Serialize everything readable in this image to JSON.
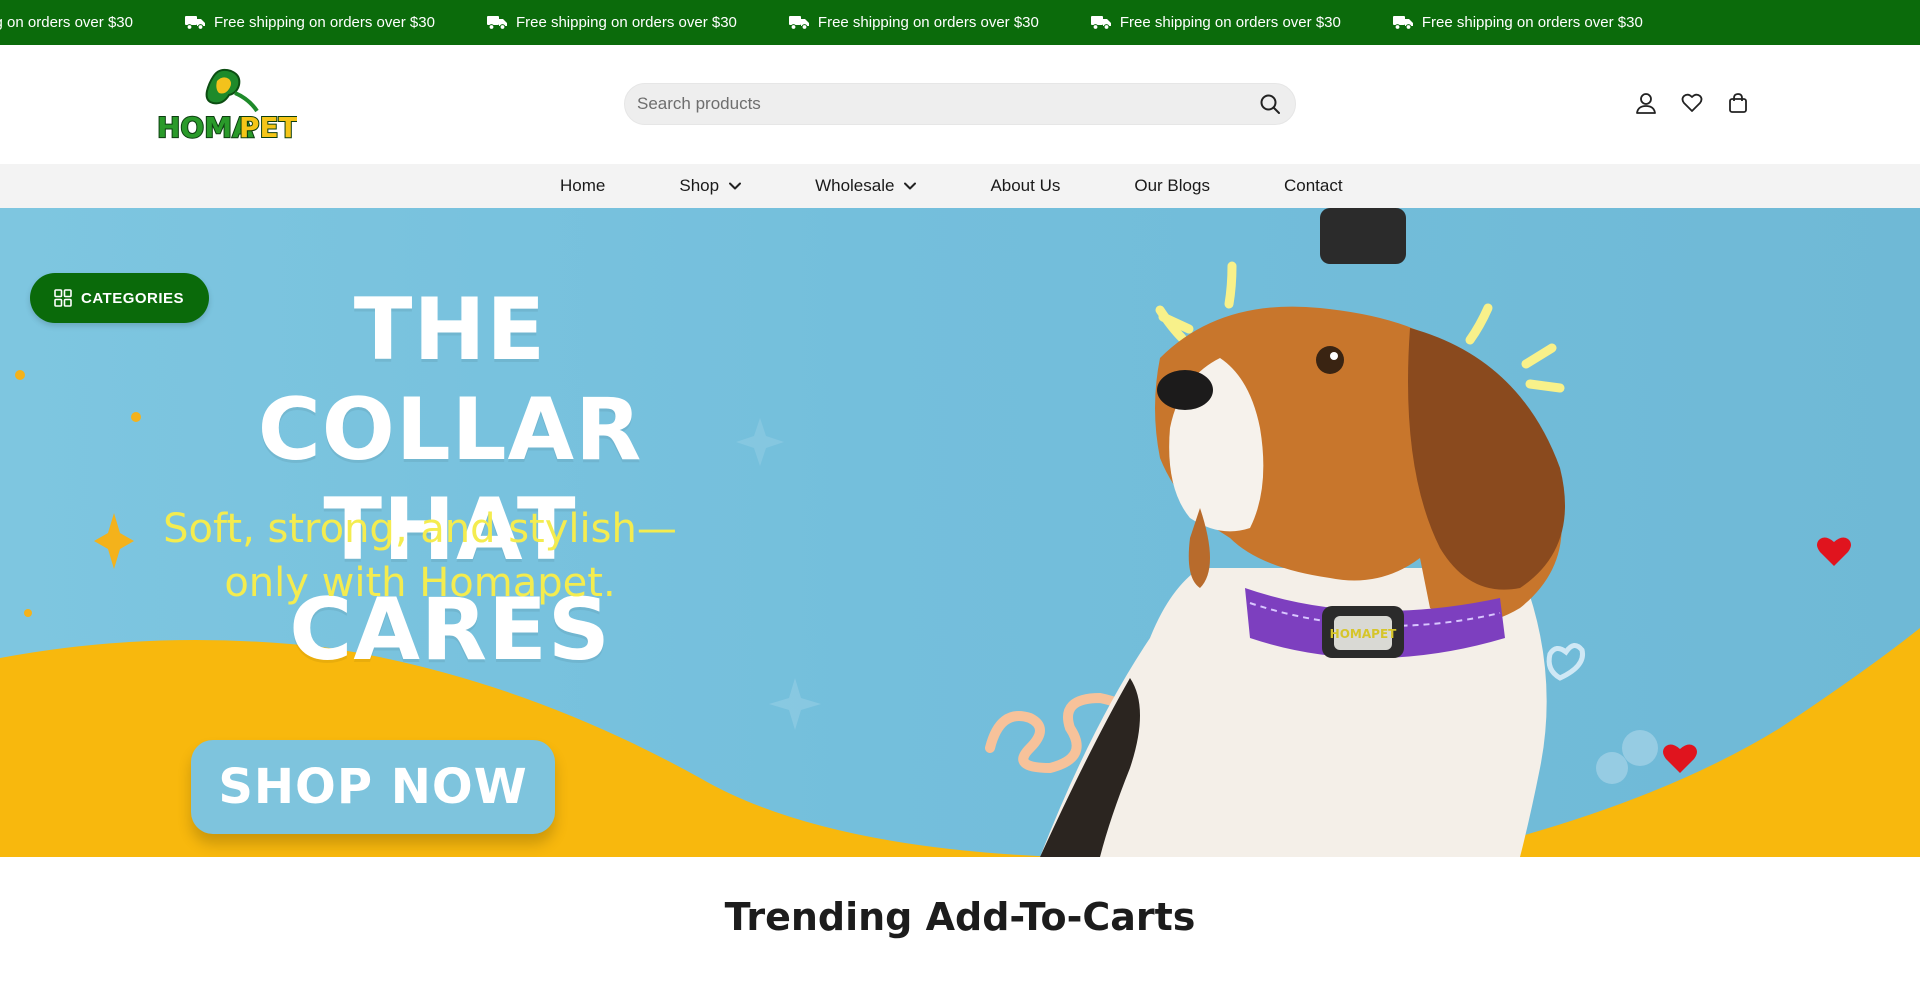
{
  "announcement": {
    "text": "Free shipping on orders over $30",
    "icon": "truck-icon",
    "repeat_items": [
      "Free shipping on orders over $30",
      "Free shipping on orders over $30",
      "Free shipping on orders over $30",
      "Free shipping on orders over $30",
      "Free shipping on orders over $30",
      "Free shipping on orders over $30"
    ],
    "background": "#0b6b0b"
  },
  "header": {
    "logo_text": "HOMAPET",
    "search": {
      "placeholder": "Search products",
      "value": ""
    },
    "icons": [
      "user-icon",
      "heart-icon",
      "shopping-bag-icon"
    ]
  },
  "nav": {
    "items": [
      {
        "label": "Home",
        "dropdown": false
      },
      {
        "label": "Shop",
        "dropdown": true
      },
      {
        "label": "Wholesale",
        "dropdown": true
      },
      {
        "label": "About Us",
        "dropdown": false
      },
      {
        "label": "Our Blogs",
        "dropdown": false
      },
      {
        "label": "Contact",
        "dropdown": false
      }
    ]
  },
  "hero": {
    "headline_line1": "THE COLLAR",
    "headline_line2": "THAT CARES",
    "subline_line1": "Soft, strong, and stylish—",
    "subline_line2": "only with Homapet.",
    "cta_label": "SHOP NOW",
    "collar_tag": "HOMAPET",
    "colors": {
      "sky": "#74bfdc",
      "wave": "#f8b80d",
      "collar": "#7d3fbf",
      "headline": "#ffffff",
      "subline": "#f4ec4f"
    }
  },
  "categories_button": {
    "label": "CATEGORIES",
    "icon": "grid-icon"
  },
  "trending": {
    "title": "Trending Add-To-Carts"
  }
}
